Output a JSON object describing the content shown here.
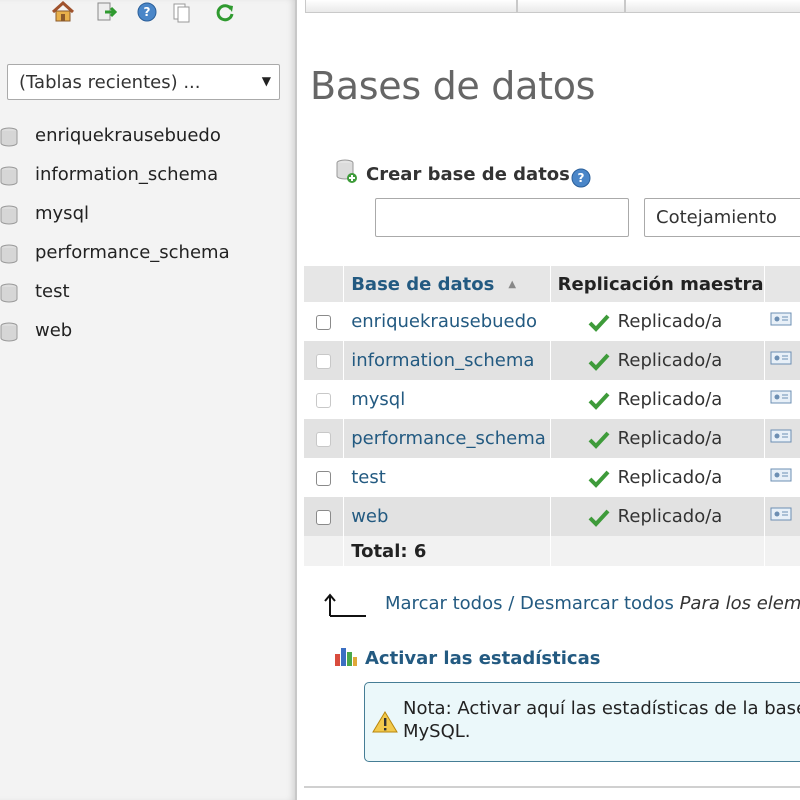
{
  "navigation": {
    "recent_tables": "(Tablas recientes) ...",
    "databases": [
      "enriquekrausebuedo",
      "information_schema",
      "mysql",
      "performance_schema",
      "test",
      "web"
    ]
  },
  "main": {
    "title": "Bases de datos",
    "create_database": {
      "label": "Crear base de datos",
      "name_value": "",
      "collation_placeholder": "Cotejamiento"
    },
    "table": {
      "headers": {
        "database": "Base de datos",
        "replication": "Replicación maestra"
      },
      "rows": [
        {
          "name": "enriquekrausebuedo",
          "replication": "Replicado/a"
        },
        {
          "name": "information_schema",
          "replication": "Replicado/a"
        },
        {
          "name": "mysql",
          "replication": "Replicado/a"
        },
        {
          "name": "performance_schema",
          "replication": "Replicado/a"
        },
        {
          "name": "test",
          "replication": "Replicado/a"
        },
        {
          "name": "web",
          "replication": "Replicado/a"
        }
      ],
      "total": "Total: 6"
    },
    "check_actions": {
      "check_all": "Marcar todos",
      "separator": " / ",
      "uncheck_all": "Desmarcar todos",
      "hint": " Para los elem"
    },
    "statistics": {
      "label": "Activar las estadísticas",
      "note_line1": "Nota: Activar aquí las estadísticas de la base",
      "note_line2": "MySQL."
    }
  },
  "icons": {
    "home": "home-icon",
    "logout": "logout-icon",
    "help": "help-icon",
    "docs": "docs-icon",
    "reload": "reload-icon"
  },
  "colors": {
    "link": "#235a81",
    "check_green": "#3e9b3a",
    "panel_bg": "#f3f3f3"
  }
}
